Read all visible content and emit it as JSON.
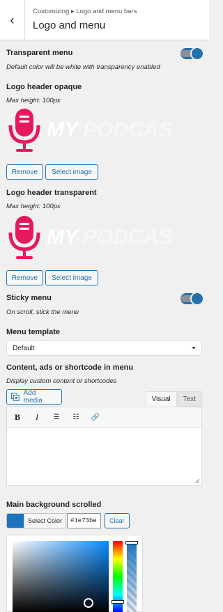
{
  "header": {
    "breadcrumb": "Customizing ▸ Logo and menu bars",
    "title": "Logo and menu",
    "back_glyph": "‹"
  },
  "transparent_menu": {
    "label": "Transparent menu",
    "description": "Default color will be white with transparency enabled",
    "enabled": true
  },
  "logo_opaque": {
    "label": "Logo header opaque",
    "max_height": "Max height: 100px",
    "logo_text": "MY",
    "logo_text2": "PODCAST",
    "remove": "Remove",
    "select": "Select image"
  },
  "logo_transparent": {
    "label": "Logo header transparent",
    "max_height": "Max height: 100px",
    "logo_text": "MY",
    "logo_text2": "PODCAST",
    "remove": "Remove",
    "select": "Select image"
  },
  "sticky_menu": {
    "label": "Sticky menu",
    "description": "On scroll, stick the menu",
    "enabled": true
  },
  "menu_template": {
    "label": "Menu template",
    "value": "Default"
  },
  "content_menu": {
    "label": "Content, ads or shortcode in menu",
    "description": "Display custom content or shortcodes",
    "add_media": "Add media",
    "tab_visual": "Visual",
    "tab_text": "Text",
    "tools": {
      "bold": "B",
      "italic": "I",
      "ul": "☰",
      "ol": "☷",
      "link": "🔗"
    }
  },
  "main_bg": {
    "label": "Main background scrolled",
    "select_color": "Select Color",
    "hex": "#1e73be",
    "clear": "Clear",
    "color": "#1e73be"
  },
  "colors": {
    "accent": "#2271b1",
    "logo_pink": "#e8185e"
  }
}
